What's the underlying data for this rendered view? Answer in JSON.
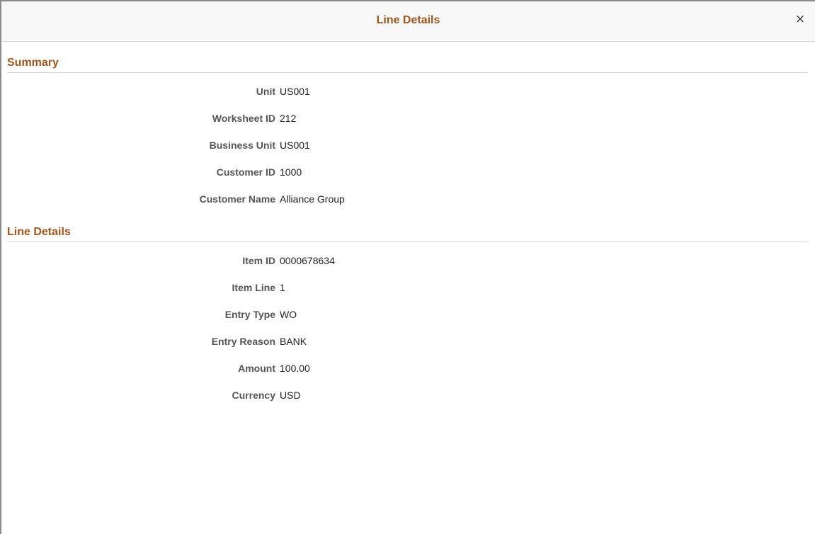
{
  "dialog": {
    "title": "Line Details",
    "close_glyph": "×"
  },
  "summary": {
    "header": "Summary",
    "fields": [
      {
        "label": "Unit",
        "value": "US001"
      },
      {
        "label": "Worksheet ID",
        "value": "212"
      },
      {
        "label": "Business Unit",
        "value": "US001"
      },
      {
        "label": "Customer ID",
        "value": "1000"
      },
      {
        "label": "Customer Name",
        "value": "Alliance Group"
      }
    ]
  },
  "line_details": {
    "header": "Line Details",
    "fields": [
      {
        "label": "Item ID",
        "value": "0000678634"
      },
      {
        "label": "Item Line",
        "value": "1"
      },
      {
        "label": "Entry Type",
        "value": "WO"
      },
      {
        "label": "Entry Reason",
        "value": "BANK"
      },
      {
        "label": "Amount",
        "value": "100.00"
      },
      {
        "label": "Currency",
        "value": "USD"
      }
    ]
  },
  "colors": {
    "accent": "#a0561c",
    "label": "#555555",
    "divider": "#d6d6d6"
  }
}
